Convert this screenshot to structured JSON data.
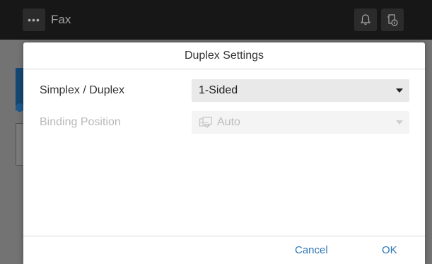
{
  "topbar": {
    "menu_glyph": "•••",
    "title": "Fax",
    "icons": [
      "bell-icon",
      "device-info-icon"
    ]
  },
  "dialog": {
    "title": "Duplex Settings",
    "rows": [
      {
        "label": "Simplex / Duplex",
        "value": "1-Sided",
        "enabled": true
      },
      {
        "label": "Binding Position",
        "value": "Auto",
        "enabled": false,
        "icon": "binding-position-icon"
      }
    ],
    "buttons": {
      "cancel": "Cancel",
      "ok": "OK"
    }
  },
  "colors": {
    "accent": "#2b76b8",
    "topbar_bg": "#1f1f1f",
    "select_bg": "#e9e9e9",
    "disabled_text": "#b8b8b8"
  }
}
